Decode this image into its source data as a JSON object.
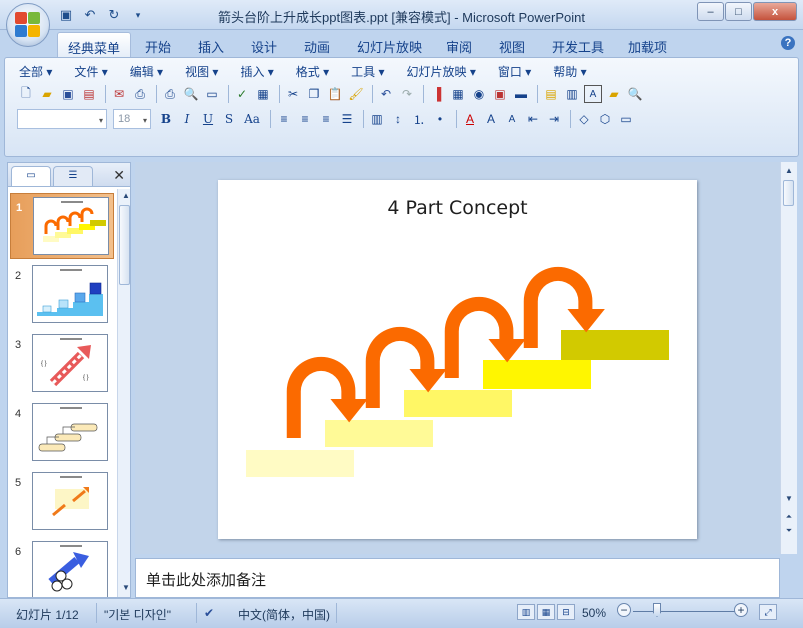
{
  "window": {
    "title": "箭头台阶上升成长ppt图表.ppt [兼容模式] - Microsoft PowerPoint",
    "controls": [
      "–",
      "□",
      "x"
    ]
  },
  "qat": [
    "save-icon",
    "undo-icon",
    "redo-icon",
    "customize-icon"
  ],
  "tabs": [
    {
      "label": "经典菜单",
      "active": true
    },
    {
      "label": "开始"
    },
    {
      "label": "插入"
    },
    {
      "label": "设计"
    },
    {
      "label": "动画"
    },
    {
      "label": "幻灯片放映"
    },
    {
      "label": "审阅"
    },
    {
      "label": "视图"
    },
    {
      "label": "开发工具"
    },
    {
      "label": "加载项"
    }
  ],
  "menu": [
    "全部 ▾",
    "文件 ▾",
    "编辑 ▾",
    "视图 ▾",
    "插入 ▾",
    "格式 ▾",
    "工具 ▾",
    "幻灯片放映 ▾",
    "窗口 ▾",
    "帮助 ▾"
  ],
  "format": {
    "font_size": "18",
    "bold": "B",
    "italic": "I",
    "underline": "U",
    "strike": "S",
    "case": "Aa"
  },
  "slides": [
    {
      "num": "1",
      "selected": true
    },
    {
      "num": "2"
    },
    {
      "num": "3"
    },
    {
      "num": "4"
    },
    {
      "num": "5"
    },
    {
      "num": "6"
    }
  ],
  "slide": {
    "title": "4 Part  Concept",
    "colors": {
      "orange": "#fb6a00",
      "step1": "#fffbc4",
      "step2": "#fffa97",
      "step3": "#fff765",
      "step4": "#fff600",
      "step5": "#d2ca00"
    }
  },
  "notes": {
    "placeholder": "单击此处添加备注"
  },
  "status": {
    "slide_info": "幻灯片 1/12",
    "theme": "\"기본 디자인\"",
    "language": "中文(简体，中国)",
    "zoom": "50%"
  },
  "accent": "#15428b"
}
